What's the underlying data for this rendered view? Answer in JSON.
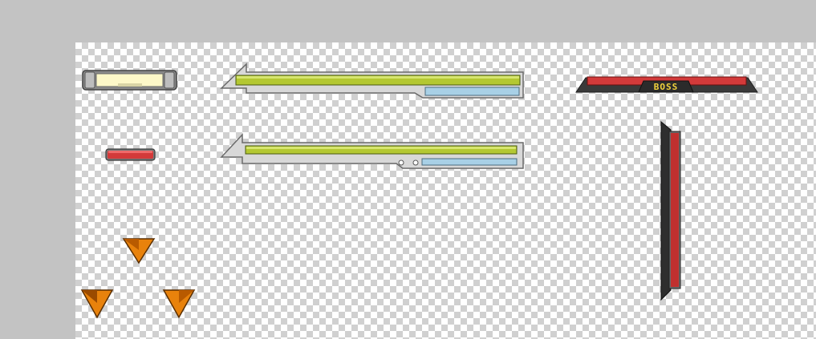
{
  "sprite_sheet": {
    "boss_bar": {
      "label": "BOSS",
      "fill_color": "#d33a3a",
      "frame_color": "#3a3a3a"
    },
    "player_bars": {
      "health_color": "#b4c832",
      "mana_color": "#a8d0e6",
      "frame_color": "#d8d8d8"
    },
    "small_bar": {
      "fill_color": "#cfeaa0"
    },
    "red_pill": {
      "fill_color": "#d33a3a"
    },
    "vertical_bar": {
      "fill_color": "#c0302f",
      "frame_color": "#2e2e2e"
    },
    "markers": {
      "color": "#e8820c",
      "icon": "orange-triangle-marker"
    }
  }
}
